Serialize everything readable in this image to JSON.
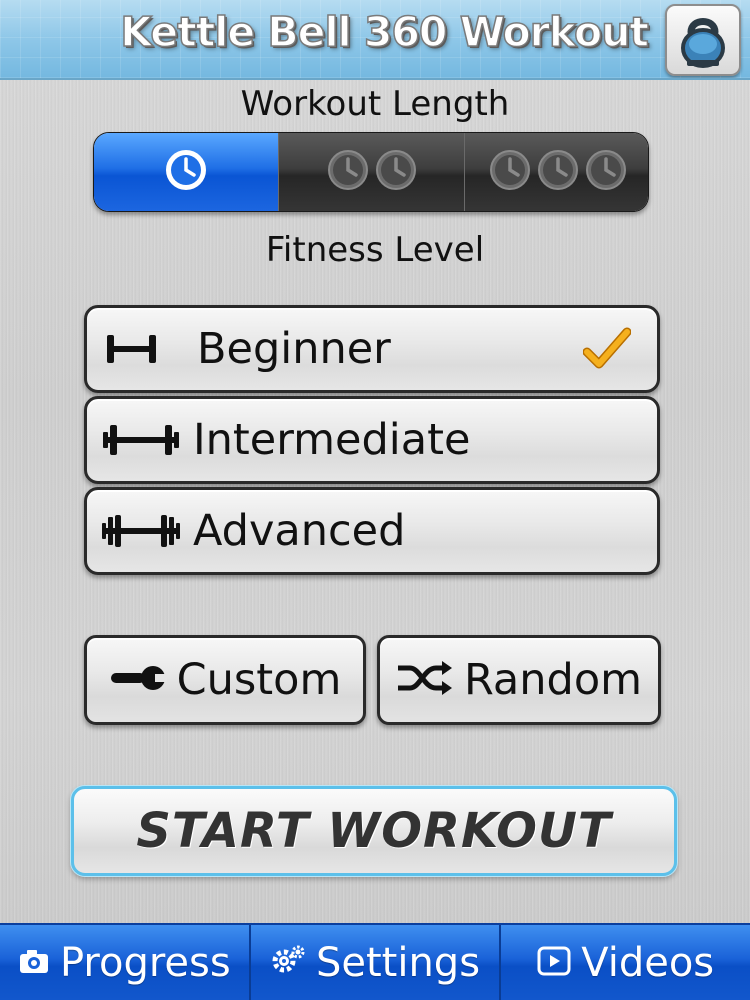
{
  "header": {
    "title": "Kettle Bell 360 Workout",
    "logo_icon": "kettlebell-icon"
  },
  "workout_length": {
    "title": "Workout Length",
    "options": [
      {
        "icon": "clock-icon",
        "clocks": 1,
        "selected": true
      },
      {
        "icon": "clock-icon",
        "clocks": 2,
        "selected": false
      },
      {
        "icon": "clock-icon",
        "clocks": 3,
        "selected": false
      }
    ]
  },
  "fitness_level": {
    "title": "Fitness Level",
    "options": [
      {
        "label": "Beginner",
        "icon": "dumbbell-small-icon",
        "selected": true
      },
      {
        "label": "Intermediate",
        "icon": "dumbbell-medium-icon",
        "selected": false
      },
      {
        "label": "Advanced",
        "icon": "dumbbell-large-icon",
        "selected": false
      }
    ]
  },
  "actions": {
    "custom_label": "Custom",
    "custom_icon": "wrench-icon",
    "random_label": "Random",
    "random_icon": "shuffle-icon",
    "start_label": "START WORKOUT"
  },
  "tabbar": {
    "tabs": [
      {
        "label": "Progress",
        "icon": "camera-icon"
      },
      {
        "label": "Settings",
        "icon": "gear-icon"
      },
      {
        "label": "Videos",
        "icon": "play-icon"
      }
    ]
  },
  "colors": {
    "header_blue": "#8ec7e8",
    "selected_blue": "#1f6fe6",
    "start_border": "#5cc0ea",
    "check_orange": "#f0a21a"
  }
}
